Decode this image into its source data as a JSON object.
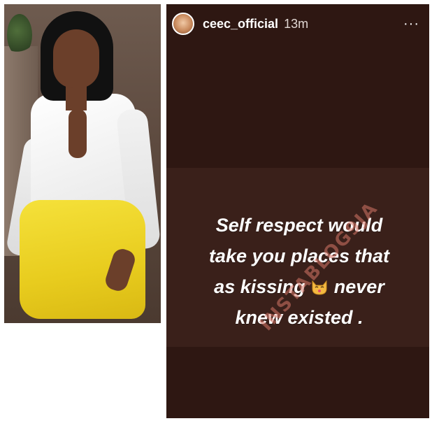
{
  "story": {
    "username": "ceec_official",
    "time": "13m",
    "more_icon": "···",
    "caption_lines": [
      "Self respect would",
      "take you places that",
      "a",
      "s kissing",
      "never",
      "knew existed ."
    ],
    "emoji_icon": "kissing-cat-emoji-icon",
    "watermark": "INSTABLOG9JA"
  },
  "colors": {
    "story_background": "#2e1712",
    "text": "#ffffff",
    "watermark": "#d67668"
  }
}
